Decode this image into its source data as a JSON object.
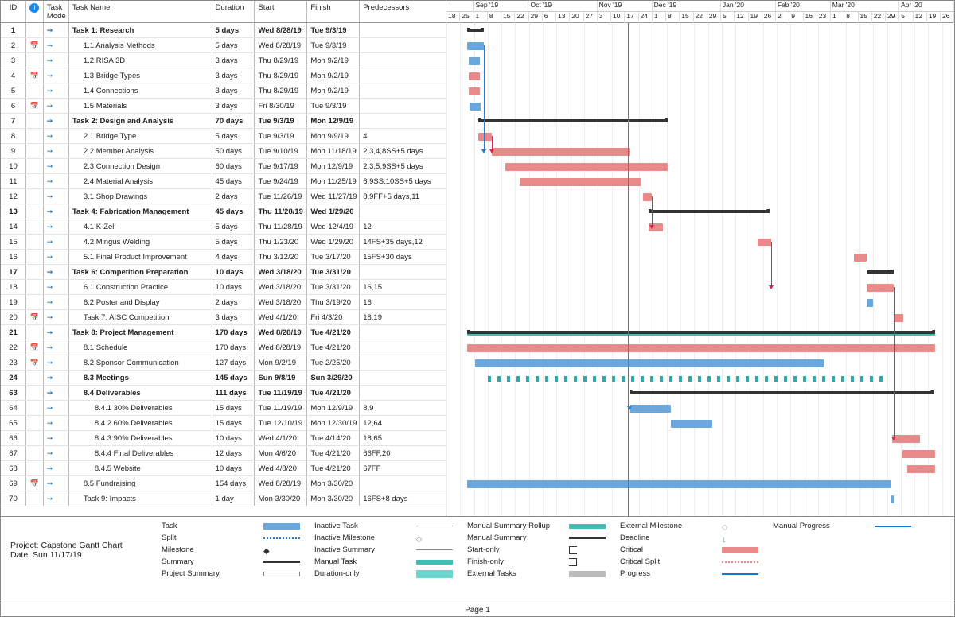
{
  "headers": {
    "id": "ID",
    "info": "",
    "mode": "Task Mode",
    "name": "Task Name",
    "dur": "Duration",
    "start": "Start",
    "finish": "Finish",
    "pred": "Predecessors"
  },
  "timeline": {
    "months": [
      {
        "label": "Sep '19",
        "weeks": 4
      },
      {
        "label": "Oct '19",
        "weeks": 5
      },
      {
        "label": "Nov '19",
        "weeks": 4
      },
      {
        "label": "Dec '19",
        "weeks": 5
      },
      {
        "label": "Jan '20",
        "weeks": 4
      },
      {
        "label": "Feb '20",
        "weeks": 4
      },
      {
        "label": "Mar '20",
        "weeks": 5
      },
      {
        "label": "Apr '20",
        "weeks": 4
      }
    ],
    "days": [
      "18",
      "25",
      "1",
      "8",
      "15",
      "22",
      "29",
      "6",
      "13",
      "20",
      "27",
      "3",
      "10",
      "17",
      "24",
      "1",
      "8",
      "15",
      "22",
      "29",
      "5",
      "12",
      "19",
      "26",
      "2",
      "9",
      "16",
      "23",
      "1",
      "8",
      "15",
      "22",
      "29",
      "5",
      "12",
      "19",
      "26"
    ],
    "today_day_index": 13.2
  },
  "chart_data": {
    "type": "gantt",
    "time_unit": "week-column (≈7 days)",
    "origin_date": "Mon 8/18/19",
    "columns_count": 37,
    "today_line": "Sun 11/17/19",
    "tasks": [
      {
        "id": 1,
        "name": "Task 1: Research",
        "dur": "5 days",
        "start": "Wed 8/28/19",
        "finish": "Tue 9/3/19",
        "pred": "",
        "bar_start": 1.5,
        "bar_len": 1.2,
        "style": "summary",
        "bold": true,
        "indent": 0,
        "calendar": false
      },
      {
        "id": 2,
        "name": "1.1 Analysis Methods",
        "dur": "5 days",
        "start": "Wed 8/28/19",
        "finish": "Tue 9/3/19",
        "pred": "",
        "bar_start": 1.5,
        "bar_len": 1.2,
        "style": "task",
        "indent": 1,
        "calendar": true
      },
      {
        "id": 3,
        "name": "1.2 RISA 3D",
        "dur": "3 days",
        "start": "Thu 8/29/19",
        "finish": "Mon 9/2/19",
        "pred": "",
        "bar_start": 1.6,
        "bar_len": 0.8,
        "style": "task",
        "indent": 1
      },
      {
        "id": 4,
        "name": "1.3 Bridge Types",
        "dur": "3 days",
        "start": "Thu 8/29/19",
        "finish": "Mon 9/2/19",
        "pred": "",
        "bar_start": 1.6,
        "bar_len": 0.8,
        "style": "critical",
        "indent": 1,
        "calendar": true
      },
      {
        "id": 5,
        "name": "1.4 Connections",
        "dur": "3 days",
        "start": "Thu 8/29/19",
        "finish": "Mon 9/2/19",
        "pred": "",
        "bar_start": 1.6,
        "bar_len": 0.8,
        "style": "critical",
        "indent": 1
      },
      {
        "id": 6,
        "name": "1.5 Materials",
        "dur": "3 days",
        "start": "Fri 8/30/19",
        "finish": "Tue 9/3/19",
        "pred": "",
        "bar_start": 1.7,
        "bar_len": 0.8,
        "style": "task",
        "indent": 1,
        "calendar": true
      },
      {
        "id": 7,
        "name": "Task 2: Design and Analysis",
        "dur": "70 days",
        "start": "Tue 9/3/19",
        "finish": "Mon 12/9/19",
        "pred": "",
        "bar_start": 2.3,
        "bar_len": 13.8,
        "style": "summary",
        "bold": true,
        "indent": 0
      },
      {
        "id": 8,
        "name": "2.1 Bridge Type",
        "dur": "5 days",
        "start": "Tue 9/3/19",
        "finish": "Mon 9/9/19",
        "pred": "4",
        "bar_start": 2.3,
        "bar_len": 1.0,
        "style": "critical",
        "indent": 1
      },
      {
        "id": 9,
        "name": "2.2 Member Analysis",
        "dur": "50 days",
        "start": "Tue 9/10/19",
        "finish": "Mon 11/18/19",
        "pred": "2,3,4,8SS+5 days",
        "bar_start": 3.3,
        "bar_len": 10.0,
        "style": "critical",
        "indent": 1
      },
      {
        "id": 10,
        "name": "2.3 Connection Design",
        "dur": "60 days",
        "start": "Tue 9/17/19",
        "finish": "Mon 12/9/19",
        "pred": "2,3,5,9SS+5 days",
        "bar_start": 4.3,
        "bar_len": 11.8,
        "style": "critical",
        "indent": 1
      },
      {
        "id": 11,
        "name": "2.4 Material Analysis",
        "dur": "45 days",
        "start": "Tue 9/24/19",
        "finish": "Mon 11/25/19",
        "pred": "6,9SS,10SS+5 days",
        "bar_start": 5.3,
        "bar_len": 8.8,
        "style": "critical",
        "indent": 1
      },
      {
        "id": 12,
        "name": "3.1 Shop Drawings",
        "dur": "2 days",
        "start": "Tue 11/26/19",
        "finish": "Wed 11/27/19",
        "pred": "8,9FF+5 days,11",
        "bar_start": 14.3,
        "bar_len": 0.6,
        "style": "critical",
        "indent": 1
      },
      {
        "id": 13,
        "name": "Task 4: Fabrication Management",
        "dur": "45 days",
        "start": "Thu 11/28/19",
        "finish": "Wed 1/29/20",
        "pred": "",
        "bar_start": 14.7,
        "bar_len": 8.8,
        "style": "summary",
        "bold": true,
        "indent": 0
      },
      {
        "id": 14,
        "name": "4.1 K-Zell",
        "dur": "5 days",
        "start": "Thu 11/28/19",
        "finish": "Wed 12/4/19",
        "pred": "12",
        "bar_start": 14.7,
        "bar_len": 1.0,
        "style": "critical",
        "indent": 1
      },
      {
        "id": 15,
        "name": "4.2 Mingus Welding",
        "dur": "5 days",
        "start": "Thu 1/23/20",
        "finish": "Wed 1/29/20",
        "pred": "14FS+35 days,12",
        "bar_start": 22.6,
        "bar_len": 1.0,
        "style": "critical",
        "indent": 1
      },
      {
        "id": 16,
        "name": "5.1 Final Product Improvement",
        "dur": "4 days",
        "start": "Thu 3/12/20",
        "finish": "Tue 3/17/20",
        "pred": "15FS+30 days",
        "bar_start": 29.6,
        "bar_len": 0.9,
        "style": "critical",
        "indent": 1
      },
      {
        "id": 17,
        "name": "Task 6: Competition Preparation",
        "dur": "10 days",
        "start": "Wed 3/18/20",
        "finish": "Tue 3/31/20",
        "pred": "",
        "bar_start": 30.5,
        "bar_len": 2.0,
        "style": "summary",
        "bold": true,
        "indent": 0
      },
      {
        "id": 18,
        "name": "6.1 Construction Practice",
        "dur": "10 days",
        "start": "Wed 3/18/20",
        "finish": "Tue 3/31/20",
        "pred": "16,15",
        "bar_start": 30.5,
        "bar_len": 2.0,
        "style": "critical",
        "indent": 1
      },
      {
        "id": 19,
        "name": "6.2 Poster and Display",
        "dur": "2 days",
        "start": "Wed 3/18/20",
        "finish": "Thu 3/19/20",
        "pred": "16",
        "bar_start": 30.5,
        "bar_len": 0.5,
        "style": "task",
        "indent": 1
      },
      {
        "id": 20,
        "name": "Task 7: AISC Competition",
        "dur": "3 days",
        "start": "Wed 4/1/20",
        "finish": "Fri 4/3/20",
        "pred": "18,19",
        "bar_start": 32.5,
        "bar_len": 0.7,
        "style": "critical",
        "indent": 1,
        "calendar": true
      },
      {
        "id": 21,
        "name": "Task 8: Project Management",
        "dur": "170 days",
        "start": "Wed 8/28/19",
        "finish": "Tue 4/21/20",
        "pred": "",
        "bar_start": 1.5,
        "bar_len": 34.0,
        "style": "summary",
        "bold": true,
        "indent": 0,
        "teal_overlay": true
      },
      {
        "id": 22,
        "name": "8.1 Schedule",
        "dur": "170 days",
        "start": "Wed 8/28/19",
        "finish": "Tue 4/21/20",
        "pred": "",
        "bar_start": 1.5,
        "bar_len": 34.0,
        "style": "critical",
        "indent": 1,
        "calendar": true
      },
      {
        "id": 23,
        "name": "8.2 Sponsor Communication",
        "dur": "127 days",
        "start": "Mon 9/2/19",
        "finish": "Tue 2/25/20",
        "pred": "",
        "bar_start": 2.1,
        "bar_len": 25.3,
        "style": "task",
        "indent": 1,
        "calendar": true
      },
      {
        "id": 24,
        "name": "8.3 Meetings",
        "dur": "145 days",
        "start": "Sun 9/8/19",
        "finish": "Sun 3/29/20",
        "pred": "",
        "bar_start": 3.0,
        "bar_len": 29.2,
        "style": "marks",
        "bold": true,
        "indent": 1
      },
      {
        "id": 63,
        "name": "8.4 Deliverables",
        "dur": "111 days",
        "start": "Tue 11/19/19",
        "finish": "Tue 4/21/20",
        "pred": "",
        "bar_start": 13.3,
        "bar_len": 22.1,
        "style": "summary",
        "bold": true,
        "indent": 1
      },
      {
        "id": 64,
        "name": "8.4.1 30% Deliverables",
        "dur": "15 days",
        "start": "Tue 11/19/19",
        "finish": "Mon 12/9/19",
        "pred": "8,9",
        "bar_start": 13.3,
        "bar_len": 3.0,
        "style": "task",
        "indent": 2
      },
      {
        "id": 65,
        "name": "8.4.2 60% Deliverables",
        "dur": "15 days",
        "start": "Tue 12/10/19",
        "finish": "Mon 12/30/19",
        "pred": "12,64",
        "bar_start": 16.3,
        "bar_len": 3.0,
        "style": "task",
        "indent": 2
      },
      {
        "id": 66,
        "name": "8.4.3 90% Deliverables",
        "dur": "10 days",
        "start": "Wed 4/1/20",
        "finish": "Tue 4/14/20",
        "pred": "18,65",
        "bar_start": 32.4,
        "bar_len": 2.0,
        "style": "critical",
        "indent": 2
      },
      {
        "id": 67,
        "name": "8.4.4 Final Deliverables",
        "dur": "12 days",
        "start": "Mon 4/6/20",
        "finish": "Tue 4/21/20",
        "pred": "66FF,20",
        "bar_start": 33.1,
        "bar_len": 2.4,
        "style": "critical",
        "indent": 2
      },
      {
        "id": 68,
        "name": "8.4.5 Website",
        "dur": "10 days",
        "start": "Wed 4/8/20",
        "finish": "Tue 4/21/20",
        "pred": "67FF",
        "bar_start": 33.5,
        "bar_len": 2.0,
        "style": "critical",
        "indent": 2
      },
      {
        "id": 69,
        "name": "8.5 Fundraising",
        "dur": "154 days",
        "start": "Wed 8/28/19",
        "finish": "Mon 3/30/20",
        "pred": "",
        "bar_start": 1.5,
        "bar_len": 30.8,
        "style": "task",
        "indent": 1,
        "calendar": true
      },
      {
        "id": 70,
        "name": "Task 9: Impacts",
        "dur": "1 day",
        "start": "Mon 3/30/20",
        "finish": "Mon 3/30/20",
        "pred": "16FS+8 days",
        "bar_start": 32.3,
        "bar_len": 0.2,
        "style": "task",
        "indent": 1
      }
    ]
  },
  "legend": {
    "project": "Project: Capstone Gantt Chart",
    "date": "Date: Sun 11/17/19",
    "cols": [
      [
        "Task",
        "Split",
        "Milestone",
        "Summary",
        "Project Summary"
      ],
      [
        "Inactive Task",
        "Inactive Milestone",
        "Inactive Summary",
        "Manual Task",
        "Duration-only"
      ],
      [
        "Manual Summary Rollup",
        "Manual Summary",
        "Start-only",
        "Finish-only",
        "External Tasks"
      ],
      [
        "External Milestone",
        "Deadline",
        "Critical",
        "Critical Split",
        "Progress"
      ],
      [
        "Manual Progress"
      ]
    ]
  },
  "page_label": "Page 1"
}
